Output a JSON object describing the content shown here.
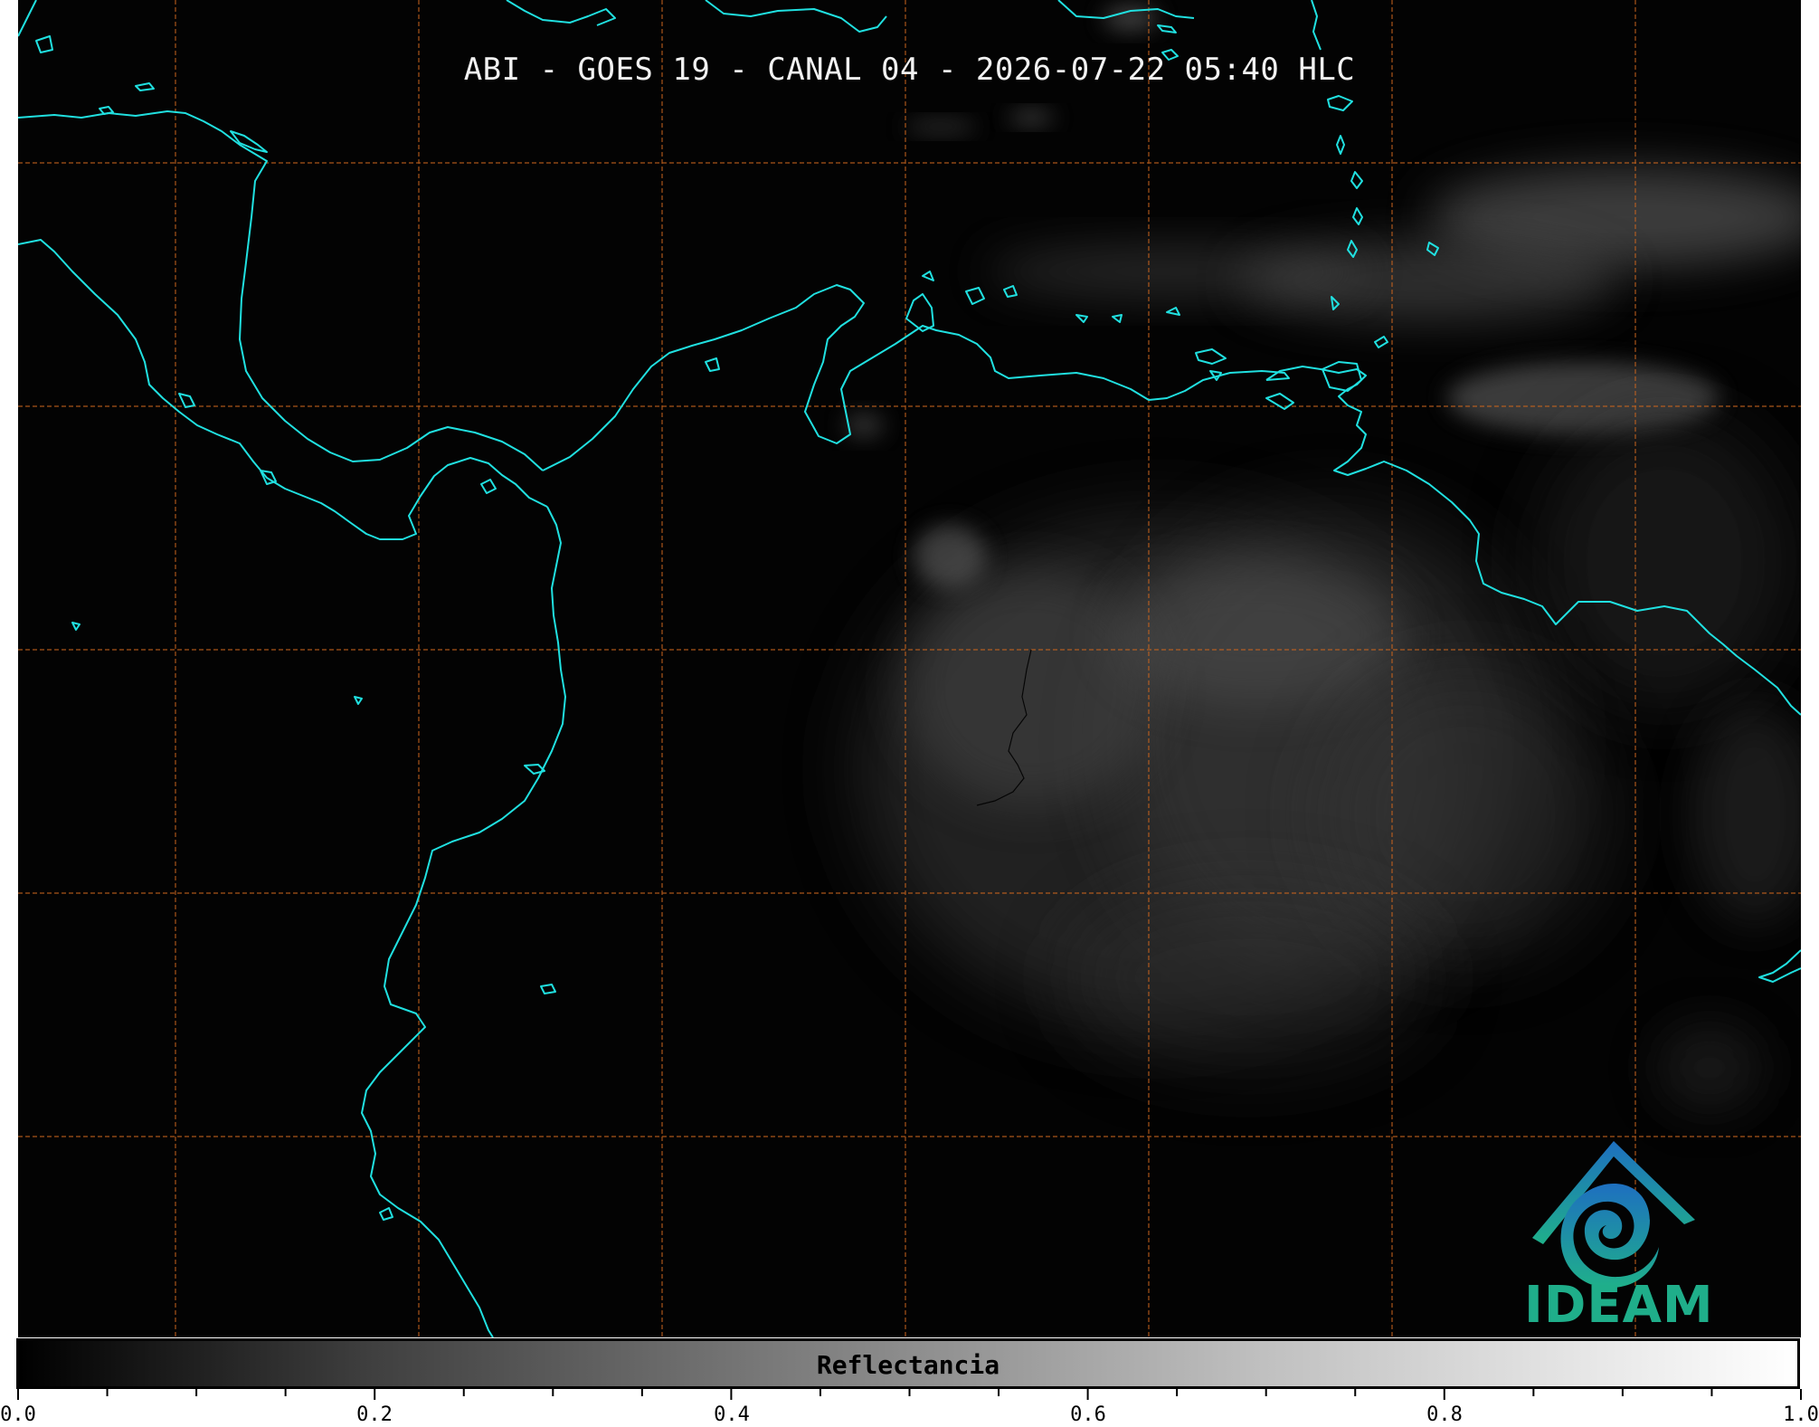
{
  "title": "ABI - GOES 19 - CANAL 04 - 2026-07-22 05:40 HLC",
  "colorbar": {
    "label": "Reflectancia",
    "range": [
      0.0,
      1.0
    ],
    "major_ticks": [
      "0.0",
      "0.2",
      "0.4",
      "0.6",
      "0.8",
      "1.0"
    ]
  },
  "logo": {
    "text": "IDEAM",
    "icon": "ideam-logo-icon"
  },
  "colors": {
    "coastline": "#20e0e0",
    "gridlines": "#c8641e",
    "background": "#030303",
    "logo_text": "#1fae8a"
  }
}
